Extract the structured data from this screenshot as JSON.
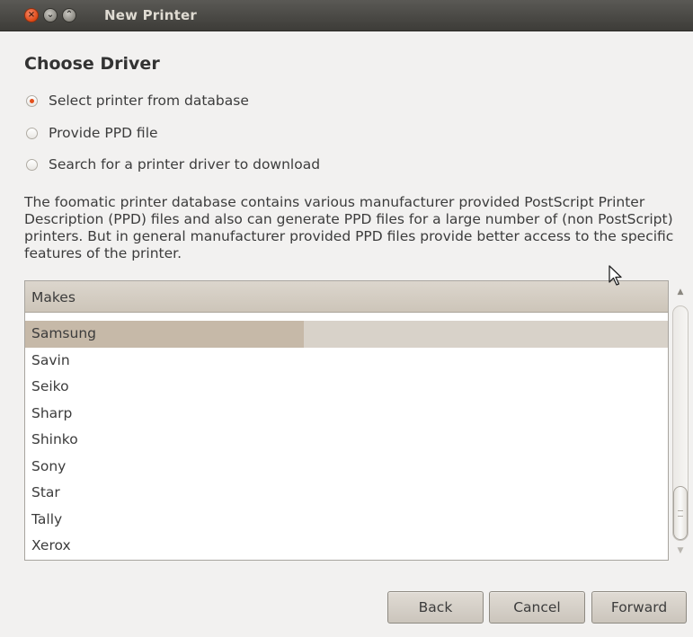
{
  "window": {
    "title": "New Printer",
    "buttons": {
      "close": "×",
      "minimize": "⌄",
      "maximize": "⌃"
    }
  },
  "page": {
    "heading": "Choose Driver",
    "options": [
      {
        "label": "Select printer from database",
        "checked": true
      },
      {
        "label": "Provide PPD file",
        "checked": false
      },
      {
        "label": "Search for a printer driver to download",
        "checked": false
      }
    ],
    "description": "The foomatic printer database contains various manufacturer provided PostScript Printer Description (PPD) files and also can generate PPD files for a large number of (non PostScript) printers. But in general manufacturer provided PPD files provide better access to the specific features of the printer."
  },
  "makes_list": {
    "header": "Makes",
    "items": [
      "Samsung",
      "Savin",
      "Seiko",
      "Sharp",
      "Shinko",
      "Sony",
      "Star",
      "Tally",
      "Xerox"
    ],
    "selected": "Samsung",
    "scroll_up_icon": "▲",
    "scroll_down_icon": "▼"
  },
  "footer": {
    "back_label": "Back",
    "cancel_label": "Cancel",
    "forward_label": "Forward"
  },
  "colors": {
    "accent": "#dd4814",
    "titlebar": "#3d3c38",
    "selection": "#c6b9a8"
  }
}
